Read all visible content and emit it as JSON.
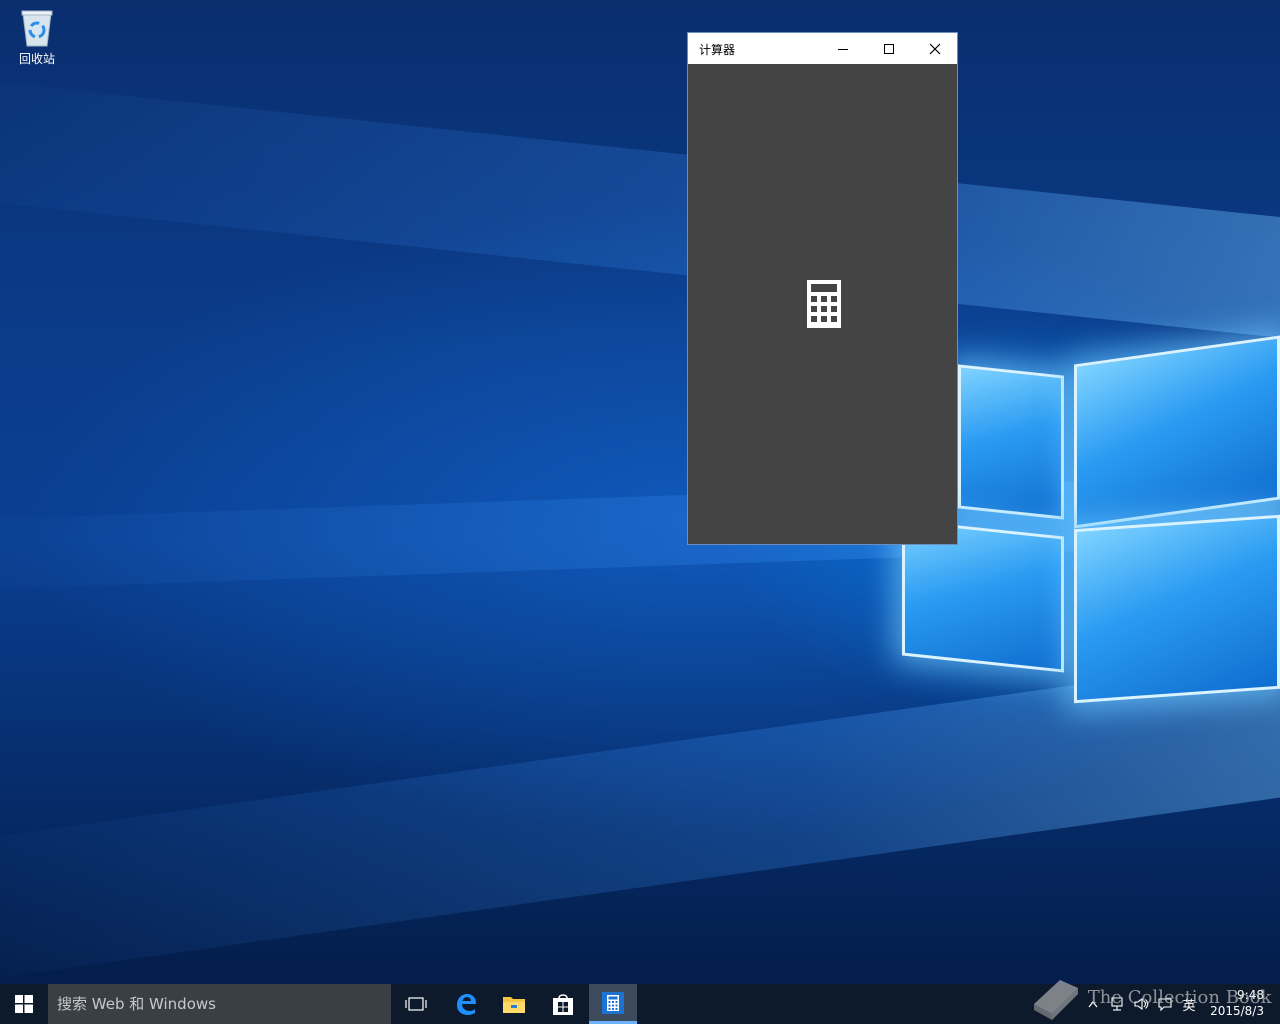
{
  "desktop": {
    "icons": [
      {
        "label": "回收站",
        "icon": "recycle-bin-icon"
      }
    ]
  },
  "calculator_window": {
    "title": "计算器",
    "controls": [
      "minimize-icon",
      "maximize-icon",
      "close-icon"
    ],
    "content_color": "#444444",
    "splash_icon": "calculator-icon"
  },
  "taskbar": {
    "start_icon": "windows-logo-icon",
    "search": {
      "placeholder": "搜索 Web 和 Windows"
    },
    "pinned": [
      {
        "name": "task-view",
        "icon": "task-view-icon"
      },
      {
        "name": "edge",
        "icon": "edge-icon"
      },
      {
        "name": "file-explorer",
        "icon": "folder-icon"
      },
      {
        "name": "store",
        "icon": "store-icon"
      },
      {
        "name": "calculator",
        "icon": "calculator-icon",
        "active": true
      }
    ],
    "tray": {
      "icons": [
        "chevron-up-icon",
        "network-icon",
        "volume-icon",
        "notification-icon"
      ],
      "ime": "英",
      "time": "9:48",
      "date": "2015/8/3"
    }
  },
  "watermark": "The Collection Book",
  "colors": {
    "taskbar": "#0d1a2b",
    "accent": "#6ab1ff",
    "window_bg": "#444444"
  }
}
